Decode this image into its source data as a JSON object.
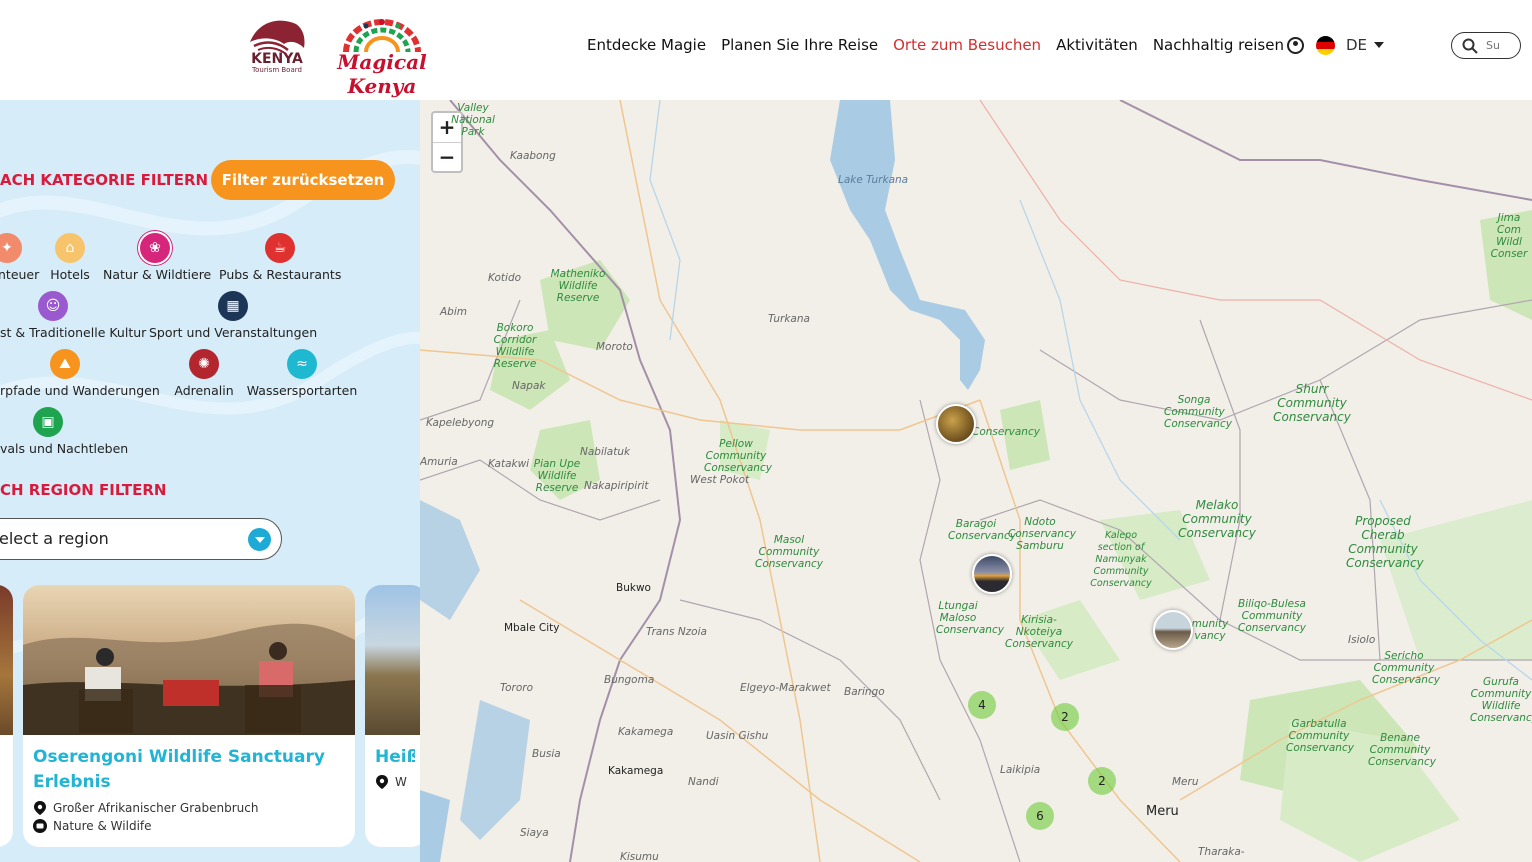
{
  "header": {
    "logo_ktb_title": "KENYA",
    "logo_ktb_subtitle": "Tourism Board",
    "logo_mk_text": "Magical Kenya",
    "nav": [
      "Entdecke Magie",
      "Planen Sie Ihre Reise",
      "Orte zum Besuchen",
      "Aktivitäten",
      "Nachhaltig reisen"
    ],
    "nav_active": "Orte zum Besuchen",
    "language": "DE",
    "search_placeholder": "Su"
  },
  "sidebar": {
    "category_title": "ACH KATEGORIE FILTERN",
    "reset_label": "Filter zurücksetzen",
    "categories": [
      {
        "label": "nteuer",
        "color": "#f28b6b",
        "icon": "adventure-icon"
      },
      {
        "label": "Hotels",
        "color": "#f7c46c",
        "icon": "hotel-icon"
      },
      {
        "label": "Natur & Wildtiere",
        "color": "#d6267b",
        "icon": "wildlife-icon"
      },
      {
        "label": "Pubs & Restaurants",
        "color": "#e03131",
        "icon": "restaurant-icon"
      },
      {
        "label": "st & Traditionelle Kultur",
        "color": "#9b59d0",
        "icon": "culture-icon"
      },
      {
        "label": "Sport und Veranstaltungen",
        "color": "#1d3557",
        "icon": "sport-icon"
      },
      {
        "label": "rpfade und Wanderungen",
        "color": "#f7941d",
        "icon": "hiking-icon"
      },
      {
        "label": "Adrenalin",
        "color": "#b3262e",
        "icon": "adrenaline-icon"
      },
      {
        "label": "Wassersportarten",
        "color": "#1eb9d0",
        "icon": "watersport-icon"
      },
      {
        "label": "vals und Nachtleben",
        "color": "#1ea34f",
        "icon": "nightlife-icon"
      }
    ],
    "region_title": "CH REGION FILTERN",
    "region_placeholder": "elect a region",
    "cards": [
      {
        "title": "Oserengoni Wildlife Sanctuary Erlebnis",
        "location": "Großer Afrikanischer Grabenbruch",
        "category": "Nature & Wildife"
      },
      {
        "title": "Heiß",
        "location": "W"
      }
    ]
  },
  "map": {
    "zoom_in": "+",
    "zoom_out": "−",
    "labels": {
      "lake_turkana": "Lake Turkana",
      "turkana": "Turkana",
      "kaabong": "Kaabong",
      "kotido": "Kotido",
      "abim": "Abim",
      "moroto": "Moroto",
      "napak": "Napak",
      "kapelebyong": "Kapelebyong",
      "amuria": "Amuria",
      "katakwi": "Katakwi",
      "nabilatuk": "Nabilatuk",
      "nakapiripirit": "Nakapiripirit",
      "west_pokot": "West Pokot",
      "bukwo": "Bukwo",
      "mbale": "Mbale City",
      "trans_nzoia": "Trans Nzoia",
      "tororo": "Tororo",
      "bungoma": "Bungoma",
      "busia": "Busia",
      "kakamega_c": "Kakamega",
      "kakamega": "Kakamega",
      "elgeyo": "Elgeyo-Marakwet",
      "baringo": "Baringo",
      "uasin": "Uasin Gishu",
      "nandi": "Nandi",
      "siaya": "Siaya",
      "kisumu": "Kisumu",
      "laikipia": "Laikipia",
      "meru_c": "Meru",
      "meru": "Meru",
      "isiolo": "Isiolo",
      "tharaka": "Tharaka-",
      "valley_np": "Valley National Park",
      "matheniko": "Matheniko Wildlife Reserve",
      "bokoro": "Bokoro Corridor Wildlife Reserve",
      "pian_upe": "Pian Upe Wildlife Reserve",
      "pellow": "Pellow Community Conservancy",
      "masol": "Masol Community Conservancy",
      "conservancy": "Conservancy",
      "baragoi": "Baragoi Conservancy",
      "ndoto": "Ndoto Conservancy Samburu",
      "kalepo": "Kalepo section of Namunyak Community Conservancy",
      "ltungai": "Ltungai Maloso Conservancy",
      "kirisia": "Kirisia-Nkoteiya Conservancy",
      "songa": "Songa Community Conservancy",
      "shurr": "Shurr Community Conservancy",
      "melako": "Melako Community Conservancy",
      "cherab": "Proposed Cherab Community Conservancy",
      "biliqo": "Biliqo-Bulesa Community Conservancy",
      "munity": "munity vancy",
      "sericho": "Sericho Community Conservancy",
      "gurufa": "Gurufa Community Wildlife Conservancy",
      "garbatulla": "Garbatulla Community Conservancy",
      "benane": "Benane Community Conservancy",
      "jima": "Jima Com Wildl Conser"
    },
    "clusters": [
      {
        "count": "4"
      },
      {
        "count": "2"
      },
      {
        "count": "2"
      },
      {
        "count": "6"
      }
    ]
  }
}
